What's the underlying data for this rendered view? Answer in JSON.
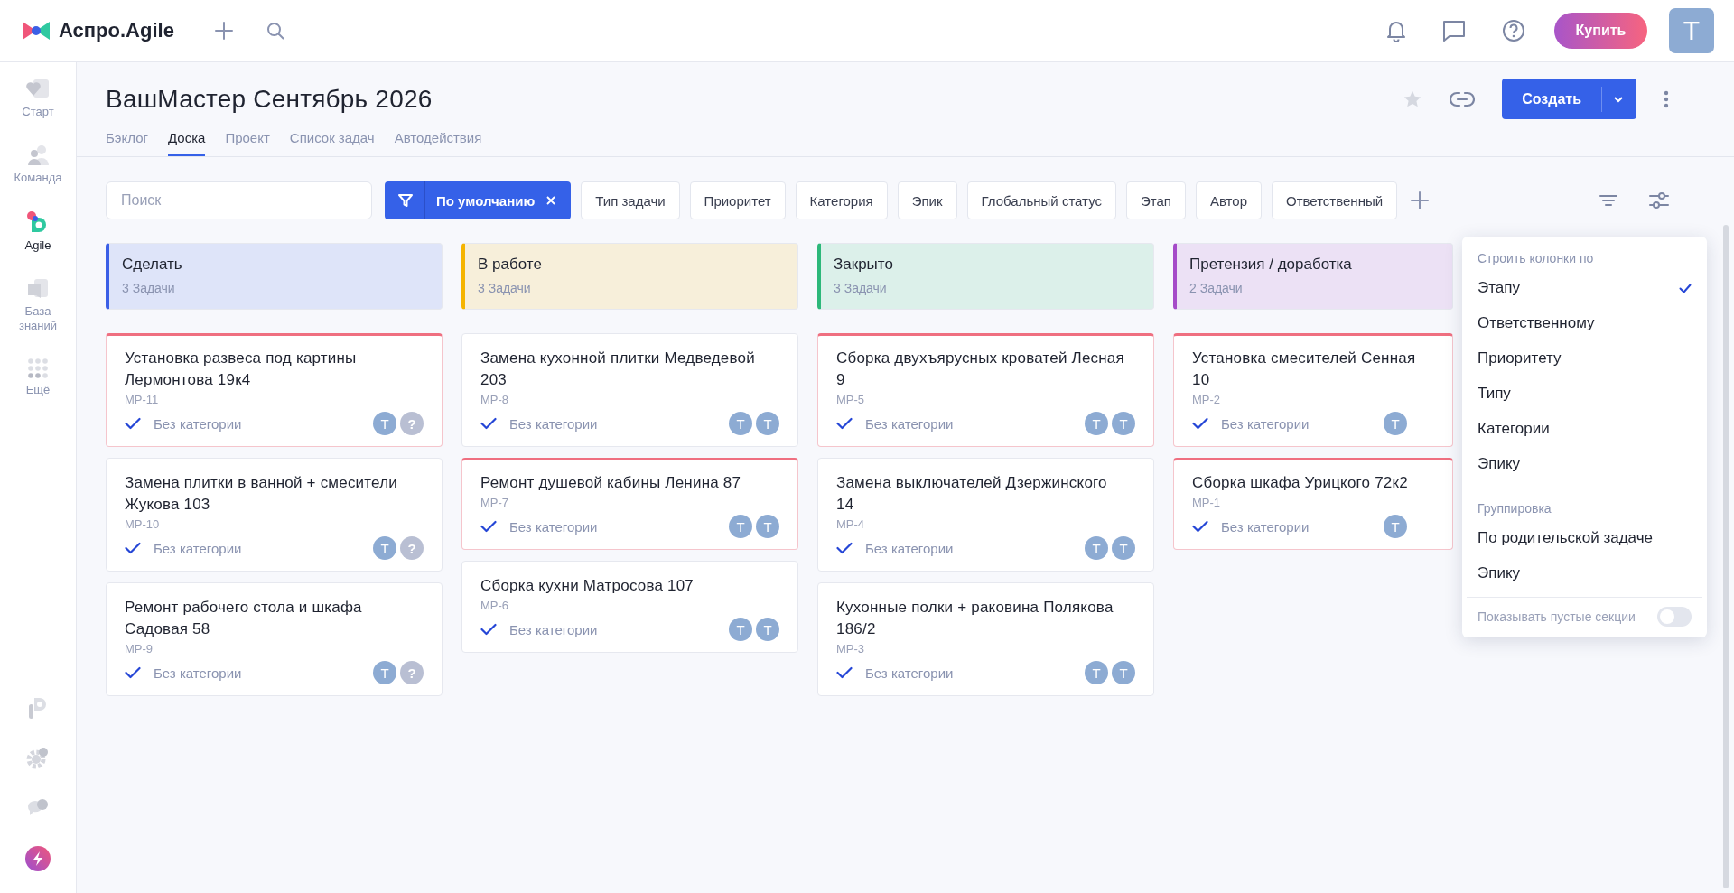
{
  "topbar": {
    "logo_text": "Аспро.Agile",
    "buy_label": "Купить",
    "avatar_letter": "Т"
  },
  "sidebar": {
    "items": [
      {
        "label": "Старт",
        "selected": false
      },
      {
        "label": "Команда",
        "selected": false
      },
      {
        "label": "Agile",
        "selected": true
      },
      {
        "label": "База знаний",
        "selected": false
      },
      {
        "label": "Ещё",
        "selected": false
      }
    ]
  },
  "page": {
    "title": "ВашМастер Сентябрь 2026",
    "create_label": "Создать",
    "tabs": [
      {
        "label": "Бэклог",
        "selected": false
      },
      {
        "label": "Доска",
        "selected": true
      },
      {
        "label": "Проект",
        "selected": false
      },
      {
        "label": "Список задач",
        "selected": false
      },
      {
        "label": "Автодействия",
        "selected": false
      }
    ]
  },
  "filters": {
    "search_placeholder": "Поиск",
    "preset": "По умолчанию",
    "chips": [
      "Тип задачи",
      "Приоритет",
      "Категория",
      "Эпик",
      "Глобальный статус",
      "Этап",
      "Автор",
      "Ответственный"
    ]
  },
  "columns": [
    {
      "title": "Сделать",
      "count": "3 Задачи",
      "color": "#3b5fe6",
      "cards": [
        {
          "title": "Установка развеса под картины Лермонтова 19к4",
          "key": "МР-11",
          "category": "Без категории",
          "urgent": true,
          "assignees": [
            {
              "kind": "user",
              "letter": "Т"
            },
            {
              "kind": "unknown",
              "letter": "?"
            }
          ]
        },
        {
          "title": "Замена плитки в ванной + смесители Жукова 103",
          "key": "МР-10",
          "category": "Без категории",
          "urgent": false,
          "assignees": [
            {
              "kind": "user",
              "letter": "Т"
            },
            {
              "kind": "unknown",
              "letter": "?"
            }
          ]
        },
        {
          "title": "Ремонт рабочего стола и шкафа Садовая 58",
          "key": "МР-9",
          "category": "Без категории",
          "urgent": false,
          "assignees": [
            {
              "kind": "user",
              "letter": "Т"
            },
            {
              "kind": "unknown",
              "letter": "?"
            }
          ]
        }
      ]
    },
    {
      "title": "В работе",
      "count": "3 Задачи",
      "color": "#f5b400",
      "cards": [
        {
          "title": "Замена кухонной плитки Медведевой 203",
          "key": "МР-8",
          "category": "Без категории",
          "urgent": false,
          "assignees": [
            {
              "kind": "user",
              "letter": "Т"
            },
            {
              "kind": "user",
              "letter": "Т"
            }
          ]
        },
        {
          "title": "Ремонт душевой кабины Ленина 87",
          "key": "МР-7",
          "category": "Без категории",
          "urgent": true,
          "assignees": [
            {
              "kind": "user",
              "letter": "Т"
            },
            {
              "kind": "user",
              "letter": "Т"
            }
          ]
        },
        {
          "title": "Сборка кухни Матросова 107",
          "key": "МР-6",
          "category": "Без категории",
          "urgent": false,
          "assignees": [
            {
              "kind": "user",
              "letter": "Т"
            },
            {
              "kind": "user",
              "letter": "Т"
            }
          ]
        }
      ]
    },
    {
      "title": "Закрыто",
      "count": "3 Задачи",
      "color": "#2db87a",
      "cards": [
        {
          "title": "Сборка двухъярусных кроватей Лесная 9",
          "key": "МР-5",
          "category": "Без категории",
          "urgent": true,
          "assignees": [
            {
              "kind": "user",
              "letter": "Т"
            },
            {
              "kind": "user",
              "letter": "Т"
            }
          ]
        },
        {
          "title": "Замена выключателей Дзержинского 14",
          "key": "МР-4",
          "category": "Без категории",
          "urgent": false,
          "assignees": [
            {
              "kind": "user",
              "letter": "Т"
            },
            {
              "kind": "user",
              "letter": "Т"
            }
          ]
        },
        {
          "title": "Кухонные полки + раковина Полякова 186/2",
          "key": "МР-3",
          "category": "Без категории",
          "urgent": false,
          "assignees": [
            {
              "kind": "user",
              "letter": "Т"
            },
            {
              "kind": "user",
              "letter": "Т"
            }
          ]
        }
      ]
    },
    {
      "title": "Претензия / доработка",
      "count": "2 Задачи",
      "color": "#a54bc8",
      "cards": [
        {
          "title": "Установка смесителей Сенная 10",
          "key": "МР-2",
          "category": "Без категории",
          "urgent": true,
          "assignees": [
            {
              "kind": "user",
              "letter": "Т"
            }
          ]
        },
        {
          "title": "Сборка шкафа Урицкого 72к2",
          "key": "МР-1",
          "category": "Без категории",
          "urgent": true,
          "assignees": [
            {
              "kind": "user",
              "letter": "Т"
            }
          ]
        }
      ]
    }
  ],
  "menu": {
    "sections": [
      {
        "heading": "Строить колонки по",
        "options": [
          {
            "label": "Этапу",
            "selected": true
          },
          {
            "label": "Ответственному",
            "selected": false
          },
          {
            "label": "Приоритету",
            "selected": false
          },
          {
            "label": "Типу",
            "selected": false
          },
          {
            "label": "Категории",
            "selected": false
          },
          {
            "label": "Эпику",
            "selected": false
          }
        ]
      },
      {
        "heading": "Группировка",
        "options": [
          {
            "label": "По родительской задаче",
            "selected": false
          },
          {
            "label": "Эпику",
            "selected": false
          }
        ]
      }
    ],
    "toggle": {
      "label": "Показывать пустые секции",
      "on": false
    }
  }
}
